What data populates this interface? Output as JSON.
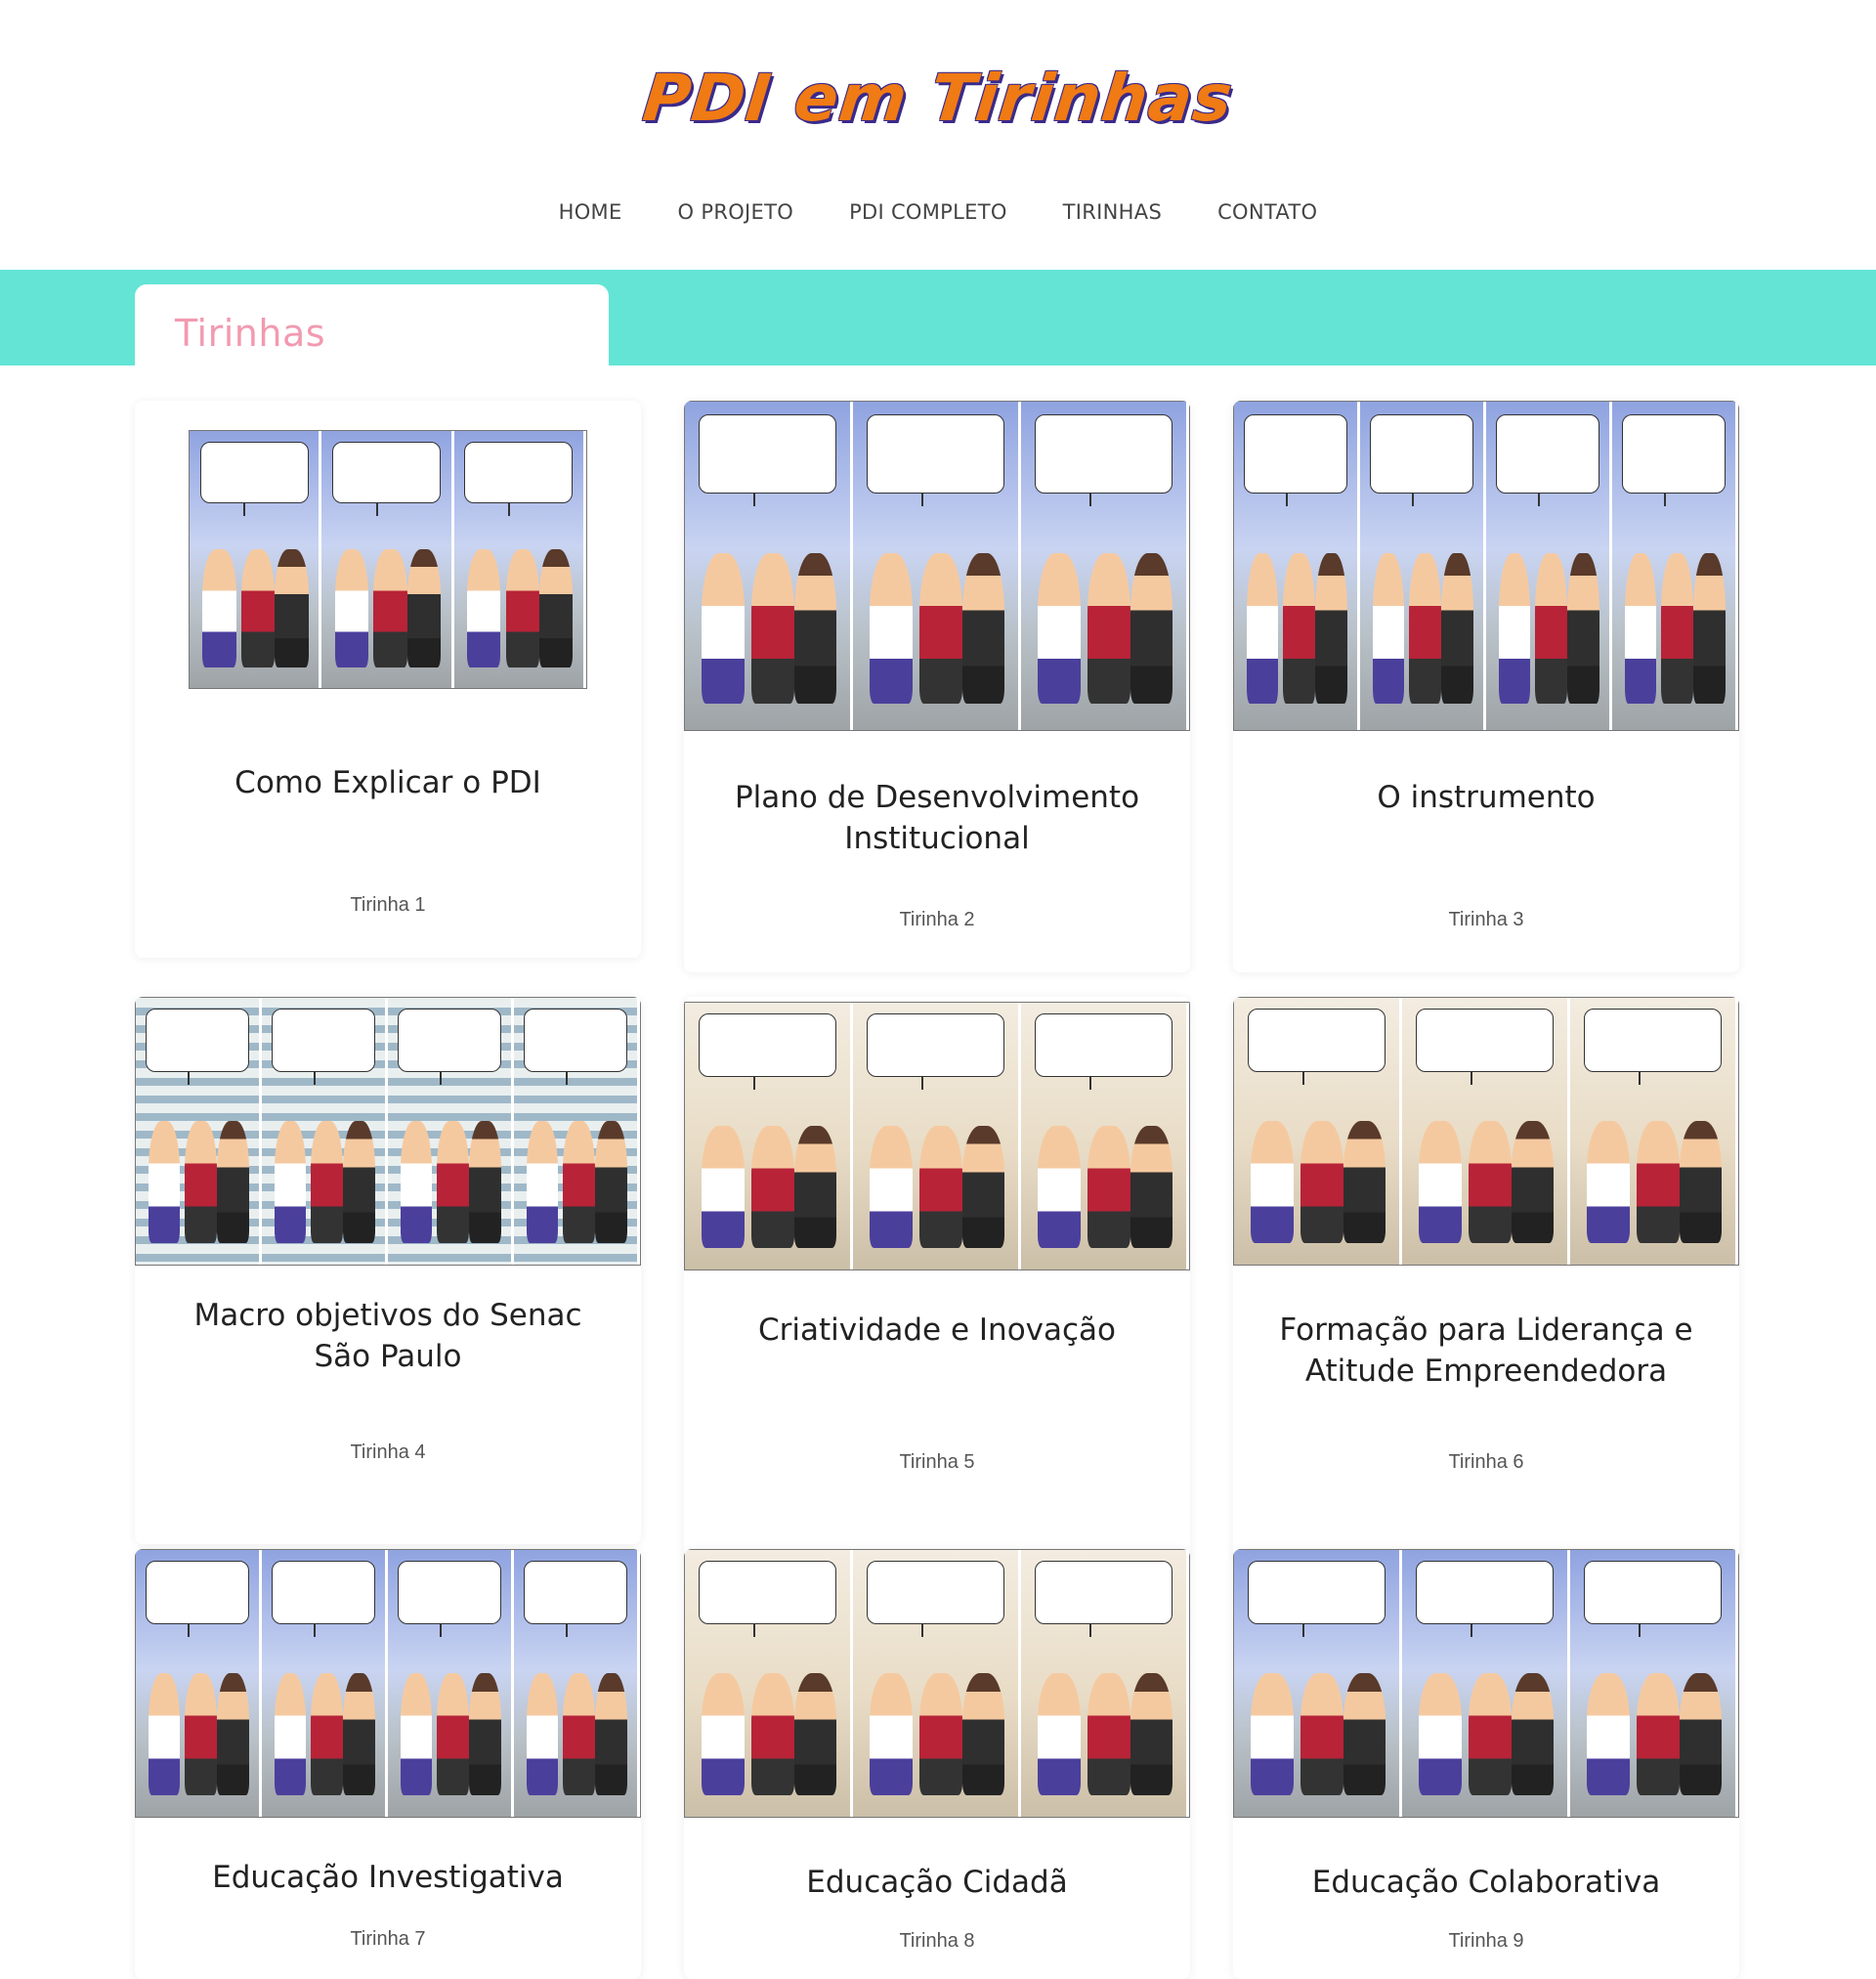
{
  "site": {
    "logo_text": "PDI em Tirinhas",
    "nav": [
      "HOME",
      "O PROJETO",
      "PDI COMPLETO",
      "TIRINHAS",
      "CONTATO"
    ]
  },
  "banner": {
    "title": "Tirinhas"
  },
  "cards": [
    {
      "title": "Como Explicar o PDI",
      "subtitle": "Tirinha 1"
    },
    {
      "title": "Plano de Desenvolvimento Institucional",
      "subtitle": "Tirinha 2"
    },
    {
      "title": "O instrumento",
      "subtitle": "Tirinha 3"
    },
    {
      "title": "Macro objetivos do Senac São Paulo",
      "subtitle": "Tirinha 4"
    },
    {
      "title": "Criatividade e Inovação",
      "subtitle": "Tirinha 5"
    },
    {
      "title": "Formação para Liderança e Atitude Empreendedora",
      "subtitle": "Tirinha 6"
    },
    {
      "title": "Educação Investigativa",
      "subtitle": "Tirinha 7"
    },
    {
      "title": "Educação Cidadã",
      "subtitle": "Tirinha 8"
    },
    {
      "title": "Educação Colaborativa",
      "subtitle": "Tirinha 9"
    }
  ],
  "colors": {
    "accent_teal": "#63e4d5",
    "logo_orange": "#f07a13",
    "tab_pink": "#f29ab0"
  }
}
